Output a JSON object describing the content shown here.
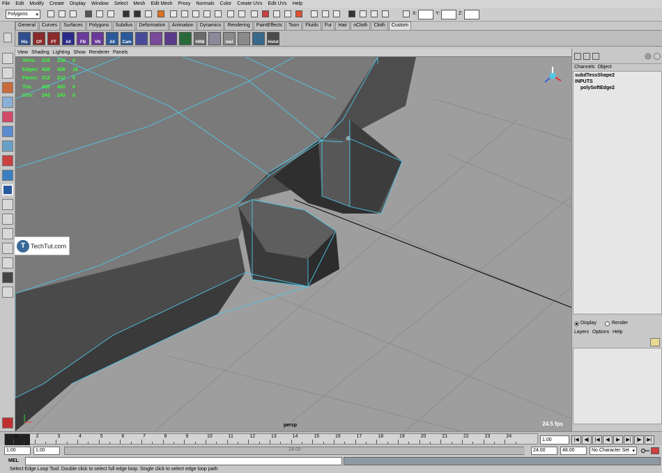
{
  "menu": [
    "File",
    "Edit",
    "Modify",
    "Create",
    "Display",
    "Window",
    "Select",
    "Mesh",
    "Edit Mesh",
    "Proxy",
    "Normals",
    "Color",
    "Create UVs",
    "Edit UVs",
    "Help"
  ],
  "status": {
    "mode": "Polygons",
    "x_label": "X:",
    "y_label": "Y:",
    "z_label": "Z:"
  },
  "shelf_tabs": [
    "General",
    "Curves",
    "Surfaces",
    "Polygons",
    "Subdivs",
    "Deformation",
    "Animation",
    "Dynamics",
    "Rendering",
    "PaintEffects",
    "Toon",
    "Fluids",
    "Fur",
    "Hair",
    "nCloth",
    "Cloth",
    "Custom"
  ],
  "shelf_active": "Custom",
  "shelf_buttons": [
    {
      "label": "His",
      "color": "#2f4f8f"
    },
    {
      "label": "CP",
      "color": "#8a2a2a"
    },
    {
      "label": "FT",
      "color": "#8a2a2a"
    },
    {
      "label": "All",
      "color": "#2a2a8a"
    },
    {
      "label": "FN",
      "color": "#6a3a9a"
    },
    {
      "label": "VN",
      "color": "#6a3a9a"
    },
    {
      "label": "All",
      "color": "#2a5a9a"
    },
    {
      "label": "Cam",
      "color": "#2a5a9a"
    },
    {
      "label": "",
      "color": "#4a4a9a"
    },
    {
      "label": "",
      "color": "#7a4a9a"
    },
    {
      "label": "",
      "color": "#5a3a8a"
    },
    {
      "label": "",
      "color": "#2a6a3a"
    },
    {
      "label": "HRB",
      "color": "#6a6a6a"
    },
    {
      "label": "",
      "color": "#8a8a9a"
    },
    {
      "label": "mel",
      "color": "#8a8a8a"
    },
    {
      "label": "",
      "color": "#8a8a8a"
    },
    {
      "label": "",
      "color": "#3a6a8a"
    },
    {
      "label": "Hshd",
      "color": "#4a4a4a"
    }
  ],
  "viewport": {
    "menu": [
      "View",
      "Shading",
      "Lighting",
      "Show",
      "Renderer",
      "Panels"
    ],
    "camera": "persp",
    "fps": "24.5 fps",
    "hud": [
      {
        "label": "Verts:",
        "a": "216",
        "b": "216",
        "c": "0"
      },
      {
        "label": "Edges:",
        "a": "426",
        "b": "426",
        "c": "16"
      },
      {
        "label": "Faces:",
        "a": "212",
        "b": "212",
        "c": "0"
      },
      {
        "label": "Tris:",
        "a": "420",
        "b": "420",
        "c": "0"
      },
      {
        "label": "UVs:",
        "a": "243",
        "b": "243",
        "c": "0"
      }
    ]
  },
  "watermark": {
    "icon": "T",
    "text": "TechTut.com"
  },
  "channelbox": {
    "menu": [
      "Channels",
      "Object"
    ],
    "shape": "subdTessShape2",
    "inputs_label": "INPUTS",
    "input_node": "polySoftEdge2",
    "display_label": "Display",
    "render_label": "Render",
    "layer_menu": [
      "Layers",
      "Options",
      "Help"
    ]
  },
  "timeline": {
    "ticks": [
      "1",
      "2",
      "3",
      "4",
      "5",
      "6",
      "7",
      "8",
      "9",
      "10",
      "11",
      "12",
      "13",
      "14",
      "15",
      "16",
      "17",
      "18",
      "19",
      "20",
      "21",
      "22",
      "23",
      "24"
    ],
    "current_time": "1.00"
  },
  "range": {
    "start": "1.00",
    "playback_start": "1.00",
    "playback_end": "24.00",
    "end": "48.00",
    "handle_label": "24.00",
    "character_set": "No Character Set"
  },
  "command": {
    "label": "MEL"
  },
  "helpline": "Select Edge Loop Tool: Double click to select full edge loop. Single click to select edge loop path"
}
